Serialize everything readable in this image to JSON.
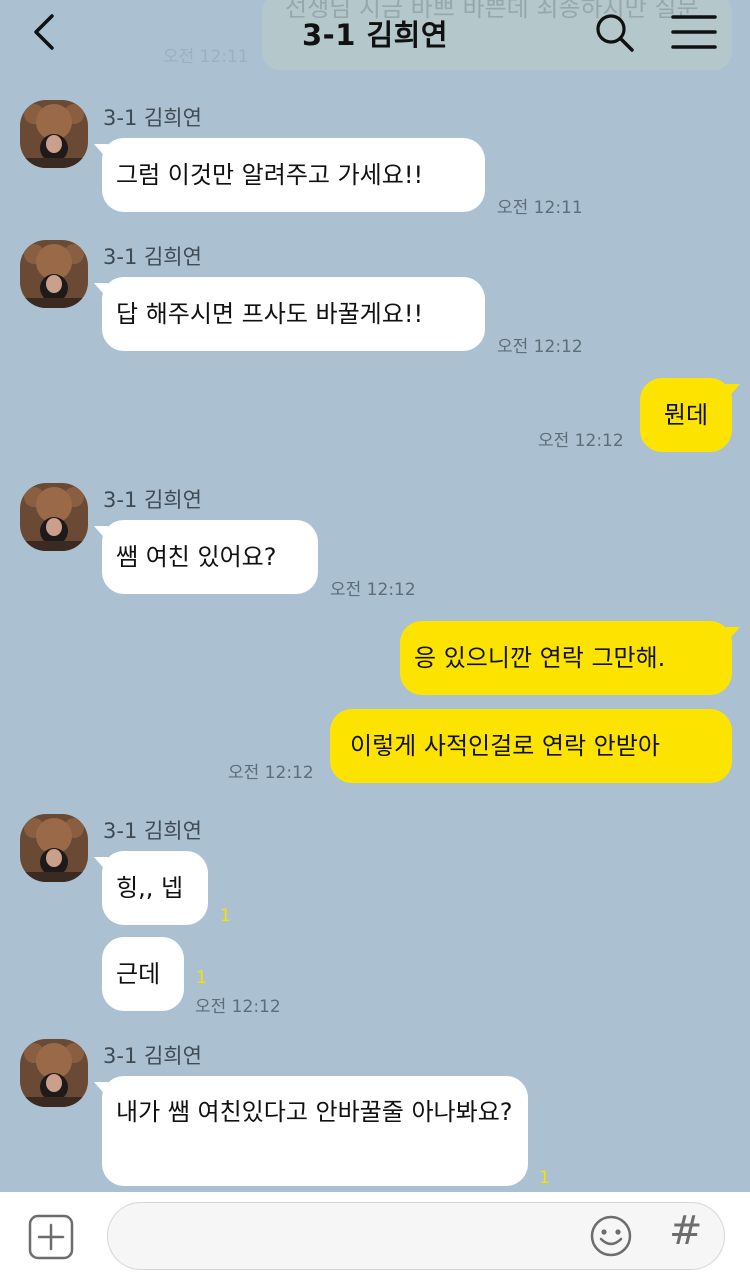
{
  "header": {
    "title": "3-1 김희연",
    "ghost_text": "선생님 지금 바쁘 바쁜데 죄송하지만 질문",
    "ghost_time": "오전 12:11"
  },
  "messages": {
    "sender_name": "3-1 김희연",
    "m1": {
      "text": "그럼 이것만 알려주고 가세요!!",
      "time": "오전 12:11"
    },
    "m2": {
      "text": "답 해주시면 프사도 바꿀게요!!",
      "time": "오전 12:12"
    },
    "m3": {
      "text": "뭔데",
      "time": "오전 12:12"
    },
    "m4": {
      "text": "쌤 여친 있어요?",
      "time": "오전 12:12"
    },
    "m5": {
      "text": "응 있으니깐 연락 그만해."
    },
    "m6": {
      "text": "이렇게 사적인걸로 연락 안받아",
      "time": "오전 12:12"
    },
    "m7": {
      "text": "힝,, 넵",
      "unread": "1"
    },
    "m8": {
      "text": "근데",
      "unread": "1",
      "time": "오전 12:12"
    },
    "m9": {
      "text": "내가 쌤 여친있다고 안바꿀줄 아나봐요?",
      "unread": "1"
    }
  },
  "icons": {
    "back": "chevron-left-icon",
    "search": "search-icon",
    "menu": "hamburger-menu-icon",
    "attach": "plus-square-icon",
    "emoji": "smiley-icon",
    "hashtag": "hashtag-icon"
  },
  "colors": {
    "background": "#abc1d1",
    "incoming_bubble": "#ffffff",
    "outgoing_bubble": "#fde400",
    "unread": "#f6e100"
  }
}
